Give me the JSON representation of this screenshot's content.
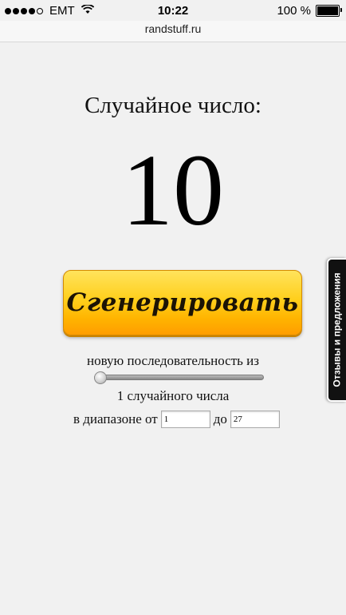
{
  "status_bar": {
    "carrier": "EMT",
    "time": "10:22",
    "battery": "100 %",
    "signal_bars_filled": 4,
    "signal_bars_total": 5
  },
  "browser": {
    "url": "randstuff.ru"
  },
  "main": {
    "heading": "Случайное число:",
    "number": "10",
    "generate_label": "Сгенерировать",
    "sequence_label": "новую последовательность из",
    "slider_value": 1,
    "count_label": "1 случайного числа",
    "range_from_label": "в диапазоне от",
    "range_from_value": "1",
    "range_to_label": "до",
    "range_to_value": "27"
  },
  "feedback": {
    "label": "Отзывы и предложения"
  },
  "colors": {
    "button_top": "#ffe35c",
    "button_bottom": "#ff9d00",
    "background": "#f1f1f1",
    "feedback_bg": "#111111"
  }
}
